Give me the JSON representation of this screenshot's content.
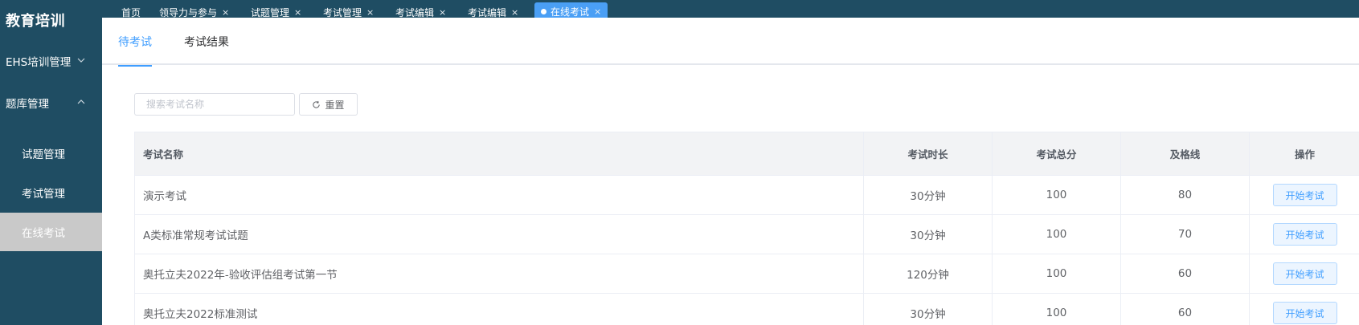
{
  "sidebar": {
    "brand": "教育培训",
    "groups": [
      {
        "label": "EHS培训管理",
        "chevron": "chevron-down-icon"
      },
      {
        "label": "题库管理",
        "chevron": "chevron-up-icon"
      }
    ],
    "items": [
      {
        "label": "试题管理"
      },
      {
        "label": "考试管理"
      },
      {
        "label": "在线考试"
      }
    ]
  },
  "tabs": [
    {
      "label": "首页",
      "close": ""
    },
    {
      "label": "领导力与参与",
      "close": "×"
    },
    {
      "label": "试题管理",
      "close": "×"
    },
    {
      "label": "考试管理",
      "close": "×"
    },
    {
      "label": "考试编辑",
      "close": "×"
    },
    {
      "label": "考试编辑",
      "close": "×"
    },
    {
      "label": "在线考试",
      "close": "×"
    }
  ],
  "subtabs": [
    {
      "label": "待考试"
    },
    {
      "label": "考试结果"
    }
  ],
  "search": {
    "placeholder": "搜索考试名称",
    "value": ""
  },
  "reset": {
    "label": "重置",
    "icon": "refresh-icon"
  },
  "table": {
    "headers": [
      "考试名称",
      "考试时长",
      "考试总分",
      "及格线",
      "操作"
    ],
    "rows": [
      {
        "name": "演示考试",
        "duration": "30分钟",
        "total": "100",
        "pass": "80",
        "action": "开始考试"
      },
      {
        "name": "A类标准常规考试试题",
        "duration": "30分钟",
        "total": "100",
        "pass": "70",
        "action": "开始考试"
      },
      {
        "name": "奥托立夫2022年-验收评估组考试第一节",
        "duration": "120分钟",
        "total": "100",
        "pass": "60",
        "action": "开始考试"
      },
      {
        "name": "奥托立夫2022标准测试",
        "duration": "30分钟",
        "total": "100",
        "pass": "60",
        "action": "开始考试"
      }
    ]
  },
  "colors": {
    "sidebar_bg": "#1f4d63",
    "accent": "#409eff",
    "active_tab": "#4a9ff5",
    "active_menu_bg": "#c9c9c9"
  }
}
